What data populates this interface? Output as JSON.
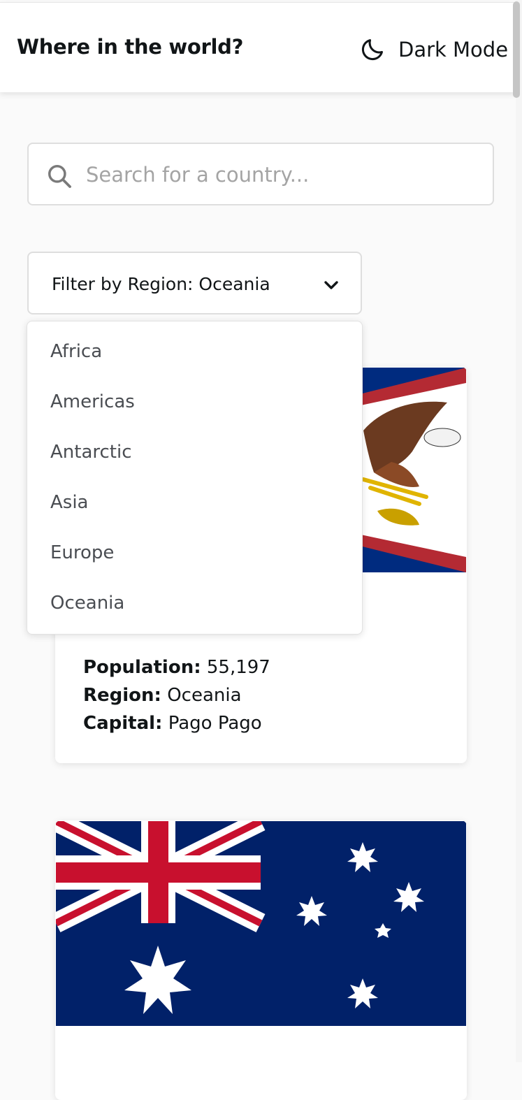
{
  "header": {
    "title": "Where in the world?",
    "theme_toggle": {
      "icon": "moon-icon",
      "label": "Dark Mode"
    }
  },
  "search": {
    "icon": "search-icon",
    "placeholder": "Search for a country...",
    "value": ""
  },
  "filter": {
    "label": "Filter by Region: Oceania",
    "selected": "Oceania",
    "icon": "chevron-down-icon",
    "options": [
      "Africa",
      "Americas",
      "Antarctic",
      "Asia",
      "Europe",
      "Oceania"
    ]
  },
  "cards": [
    {
      "flag": "american-samoa-flag",
      "population_label": "Population:",
      "population": "55,197",
      "region_label": "Region:",
      "region": "Oceania",
      "capital_label": "Capital:",
      "capital": "Pago Pago"
    },
    {
      "flag": "australia-flag"
    }
  ],
  "colors": {
    "background": "#fafafa",
    "surface": "#ffffff",
    "text": "#111517",
    "placeholder": "#a4a4a4"
  }
}
